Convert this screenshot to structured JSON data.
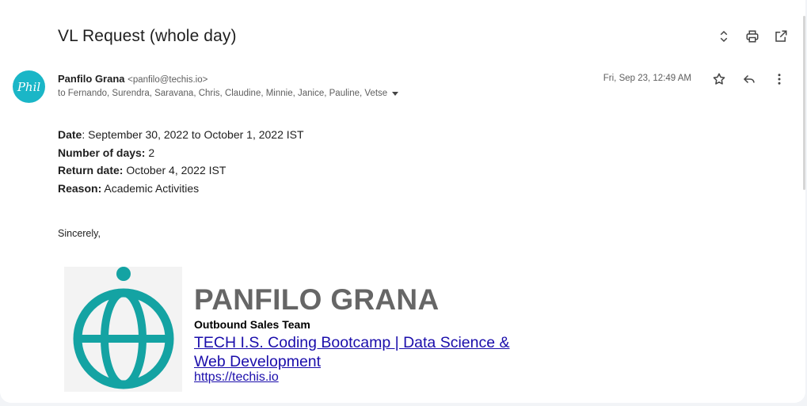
{
  "email": {
    "subject": "VL Request (whole day)",
    "sender": {
      "name": "Panfilo Grana",
      "email": "<panfilo@techis.io>",
      "avatar_text": "Phil"
    },
    "recipients": "to Fernando, Surendra, Saravana, Chris, Claudine, Minnie, Janice, Pauline, Vetse",
    "date": "Fri, Sep 23, 12:49 AM",
    "body": {
      "date_label": "Date",
      "date_value": ": September 30, 2022 to October 1, 2022 IST",
      "days_label": "Number of days:",
      "days_value": " 2",
      "return_label": "Return date:",
      "return_value": " October 4, 2022 IST",
      "reason_label": "Reason:",
      "reason_value": " Academic Activities",
      "closing": "Sincerely,"
    },
    "signature": {
      "name": "PANFILO GRANA",
      "team": "Outbound Sales Team",
      "link_text": "TECH I.S. Coding Bootcamp | Data Science & Web Development",
      "url_text": "https://techis.io",
      "logo_color": "#14a3a3"
    }
  },
  "icons": {
    "expand": "expand-collapse-icon",
    "print": "print-icon",
    "open_new": "open-in-new-window-icon",
    "star": "star-icon",
    "reply": "reply-icon",
    "more": "more-vert-icon"
  }
}
